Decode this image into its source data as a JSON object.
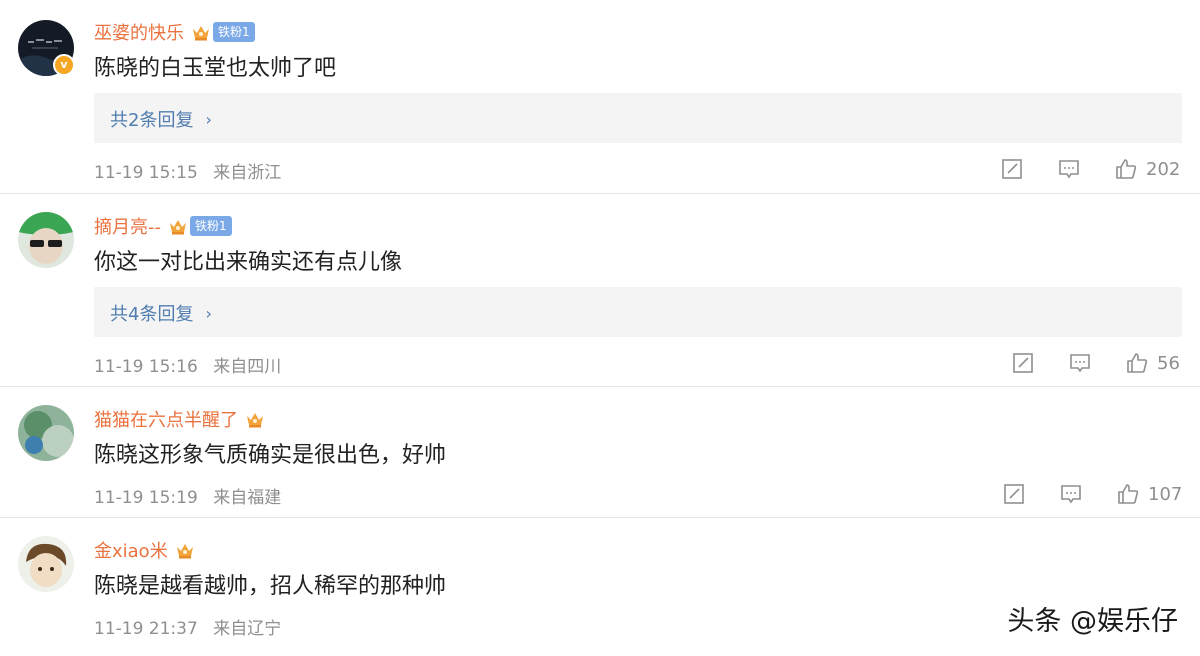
{
  "comments": [
    {
      "username": "巫婆的快乐",
      "fan_badge": "铁粉1",
      "verified": true,
      "verified_mark": "v",
      "text": "陈晓的白玉堂也太帅了吧",
      "reply_label": "共2条回复",
      "time": "11-19 15:15",
      "location": "来自浙江",
      "likes": "202"
    },
    {
      "username": "摘月亮--",
      "fan_badge": "铁粉1",
      "text": "你这一对比出来确实还有点儿像",
      "reply_label": "共4条回复",
      "time": "11-19 15:16",
      "location": "来自四川",
      "likes": "56"
    },
    {
      "username": "猫猫在六点半醒了",
      "text": "陈晓这形象气质确实是很出色，好帅",
      "time": "11-19 15:19",
      "location": "来自福建",
      "likes": "107"
    },
    {
      "username": "金xiao米",
      "text": "陈晓是越看越帅，招人稀罕的那种帅",
      "time": "11-19 21:37",
      "location": "来自辽宁"
    }
  ],
  "watermark": "头条 @娱乐仔",
  "icons": {
    "edit": "edit-icon",
    "comment": "comment-icon",
    "like": "thumbs-up-icon",
    "crown": "crown-badge-icon",
    "chevron": "chevron-right-icon"
  },
  "colors": {
    "username": "#eb7340",
    "reply_link": "#507daf",
    "meta": "#8f8f8f",
    "fan_badge": "#7ba9e8",
    "reply_bg": "#f4f4f4"
  }
}
